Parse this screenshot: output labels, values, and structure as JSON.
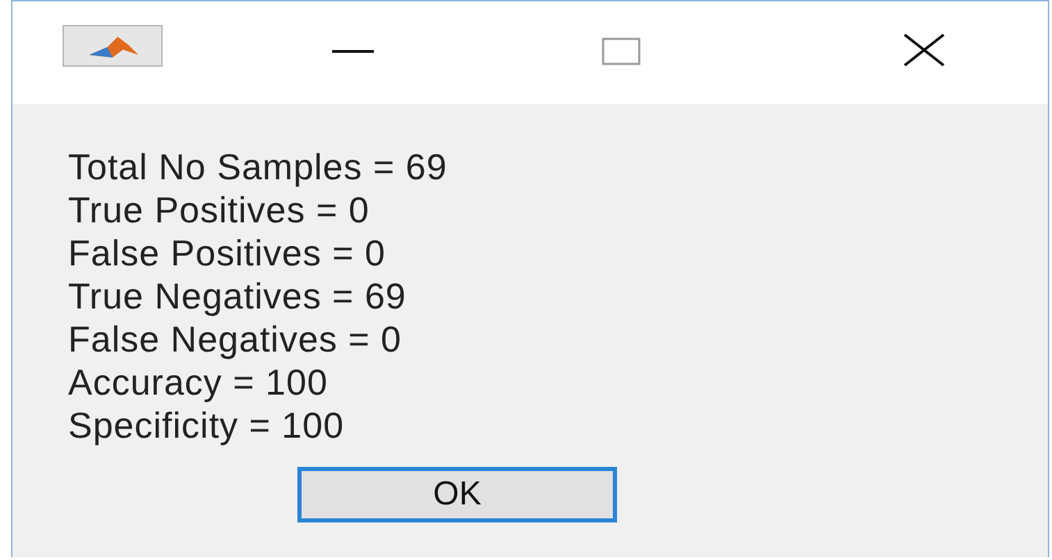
{
  "message_lines": [
    "Total No Samples = 69",
    "True Positives = 0",
    "False Positives = 0",
    "True Negatives = 69",
    "False Negatives = 0",
    "Accuracy = 100",
    "Specificity = 100"
  ],
  "buttons": [
    {
      "label": "OK",
      "focused": true
    }
  ]
}
